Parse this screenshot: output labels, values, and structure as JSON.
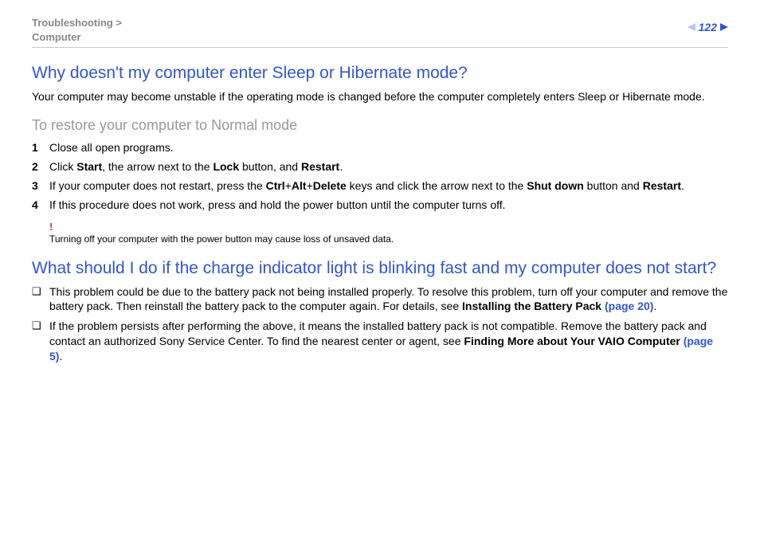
{
  "header": {
    "breadcrumb_line1": "Troubleshooting >",
    "breadcrumb_line2": "Computer",
    "page_number": "122"
  },
  "section1": {
    "title": "Why doesn't my computer enter Sleep or Hibernate mode?",
    "intro": "Your computer may become unstable if the operating mode is changed before the computer completely enters Sleep or Hibernate mode.",
    "subheading": "To restore your computer to Normal mode",
    "step1": "Close all open programs.",
    "step2_a": "Click ",
    "step2_b": "Start",
    "step2_c": ", the arrow next to the ",
    "step2_d": "Lock",
    "step2_e": " button, and ",
    "step2_f": "Restart",
    "step2_g": ".",
    "step3_a": "If your computer does not restart, press the ",
    "step3_b": "Ctrl",
    "step3_c": "+",
    "step3_d": "Alt",
    "step3_e": "+",
    "step3_f": "Delete",
    "step3_g": " keys and click the arrow next to the ",
    "step3_h": "Shut down",
    "step3_i": " button and ",
    "step3_j": "Restart",
    "step3_k": ".",
    "step4": "If this procedure does not work, press and hold the power button until the computer turns off.",
    "warn_mark": "!",
    "warn_text": "Turning off your computer with the power button may cause loss of unsaved data."
  },
  "section2": {
    "title": "What should I do if the charge indicator light is blinking fast and my computer does not start?",
    "b1_a": "This problem could be due to the battery pack not being installed properly. To resolve this problem, turn off your computer and remove the battery pack. Then reinstall the battery pack to the computer again. For details, see ",
    "b1_b": "Installing the Battery Pack ",
    "b1_link": "(page 20)",
    "b1_c": ".",
    "b2_a": "If the problem persists after performing the above, it means the installed battery pack is not compatible. Remove the battery pack and contact an authorized Sony Service Center. To find the nearest center or agent, see ",
    "b2_b": "Finding More about Your VAIO Computer ",
    "b2_link": "(page 5)",
    "b2_c": "."
  }
}
